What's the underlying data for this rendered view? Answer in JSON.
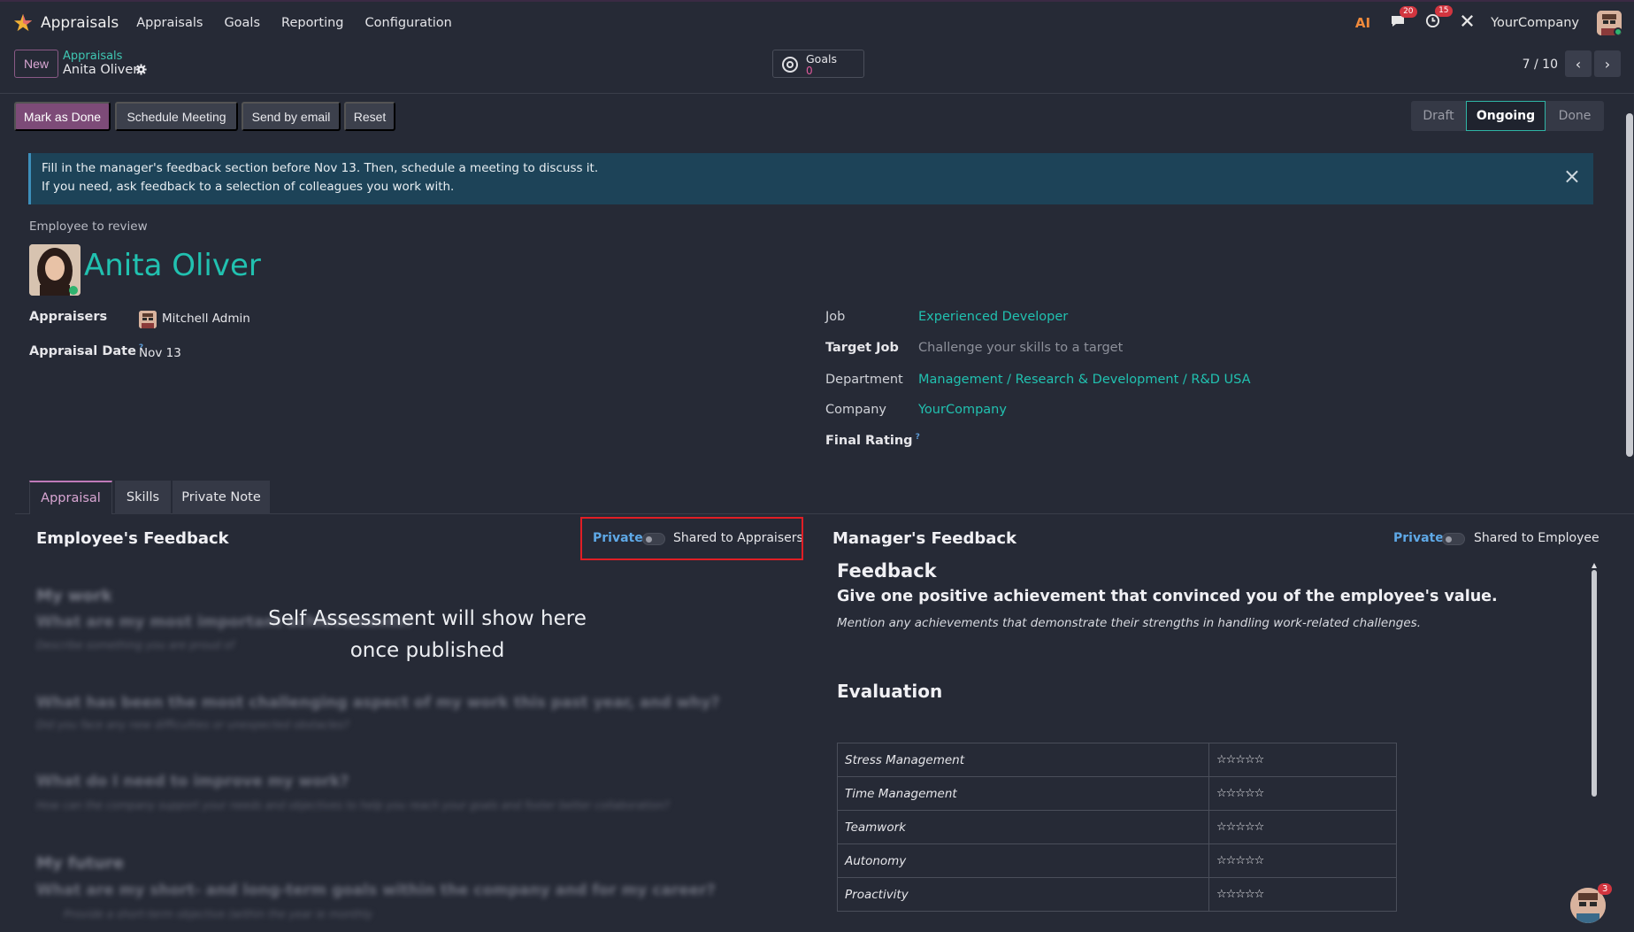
{
  "nav": {
    "app_name": "Appraisals",
    "menu": [
      "Appraisals",
      "Goals",
      "Reporting",
      "Configuration"
    ],
    "messages_count": "20",
    "activities_count": "15",
    "company": "YourCompany"
  },
  "control": {
    "new_label": "New",
    "breadcrumb_parent": "Appraisals",
    "breadcrumb_current": "Anita Oliver",
    "goals_label": "Goals",
    "goals_value": "0",
    "pager": "7 / 10"
  },
  "actions": {
    "mark_done": "Mark as Done",
    "schedule_meeting": "Schedule Meeting",
    "send_email": "Send by email",
    "reset": "Reset"
  },
  "status": [
    "Draft",
    "Ongoing",
    "Done"
  ],
  "status_active": "Ongoing",
  "alert": {
    "line1": "Fill in the manager's feedback section before Nov 13. Then, schedule a meeting to discuss it.",
    "line2": "If you need, ask feedback to a selection of colleagues you work with."
  },
  "employee": {
    "section_label": "Employee to review",
    "name": "Anita Oliver"
  },
  "fields": {
    "appraisers_label": "Appraisers",
    "appraisers_value": "Mitchell Admin",
    "appraisal_date_label": "Appraisal Date",
    "appraisal_date_value": "Nov 13",
    "help_mark": "?",
    "job_label": "Job",
    "job_value": "Experienced Developer",
    "target_job_label": "Target Job",
    "target_job_placeholder": "Challenge your skills to a target",
    "department_label": "Department",
    "department_value": "Management / Research & Development / R&D USA",
    "company_label": "Company",
    "company_value": "YourCompany",
    "final_rating_label": "Final Rating"
  },
  "tabs": [
    "Appraisal",
    "Skills",
    "Private Note"
  ],
  "employee_feedback": {
    "title": "Employee's Feedback",
    "private_label": "Private",
    "shared_label": "Shared to Appraisers",
    "overlay_line1": "Self Assessment will show here",
    "overlay_line2": "once published",
    "blurred": {
      "h1": "My work",
      "q1": "What are my most important achievements?",
      "s1": "Describe something you are proud of",
      "q2": "What has been the most challenging aspect of my work this past year, and why?",
      "s2": "Did you face any new difficulties or unexpected obstacles?",
      "q3": "What do I need to improve my work?",
      "s3": "How can the company support your needs and objectives to help you reach your goals and foster better collaboration?",
      "h2": "My future",
      "q4": "What are my short- and long-term goals within the company and for my career?",
      "s4": "Provide a short-term objective (within the year ie monthly"
    }
  },
  "manager_feedback": {
    "title": "Manager's Feedback",
    "private_label": "Private",
    "shared_label": "Shared to Employee",
    "heading": "Feedback",
    "question": "Give one positive achievement that convinced you of the employee's value.",
    "hint": "Mention any achievements that demonstrate their strengths in handling work-related challenges.",
    "evaluation_title": "Evaluation",
    "rows": [
      "Stress Management",
      "Time Management",
      "Teamwork",
      "Autonomy",
      "Proactivity"
    ],
    "stars": "☆☆☆☆☆"
  },
  "chat_badge": "3"
}
